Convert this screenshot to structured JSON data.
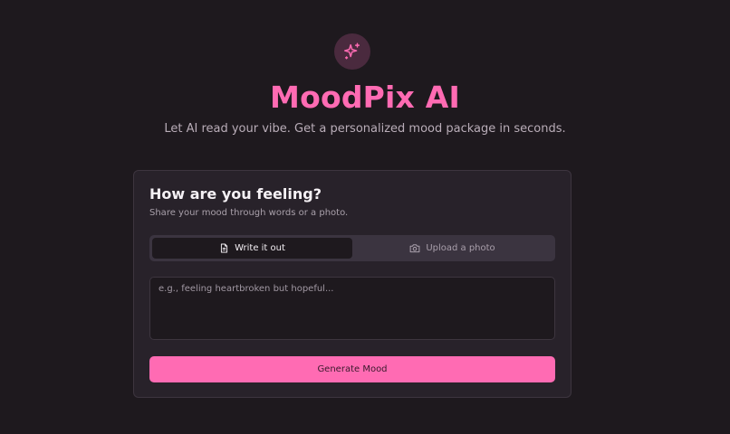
{
  "header": {
    "logo_icon": "sparkles-icon",
    "title": "MoodPix AI",
    "tagline": "Let AI read your vibe. Get a personalized mood package in seconds."
  },
  "card": {
    "title": "How are you feeling?",
    "subtitle": "Share your mood through words or a photo.",
    "tabs": [
      {
        "label": "Write it out",
        "icon": "document-icon",
        "active": true
      },
      {
        "label": "Upload a photo",
        "icon": "camera-icon",
        "active": false
      }
    ],
    "input": {
      "value": "",
      "placeholder": "e.g., feeling heartbroken but hopeful..."
    },
    "generate_label": "Generate Mood"
  },
  "colors": {
    "accent": "#ff6bb3",
    "background": "#1e191e",
    "card": "#28222a"
  }
}
